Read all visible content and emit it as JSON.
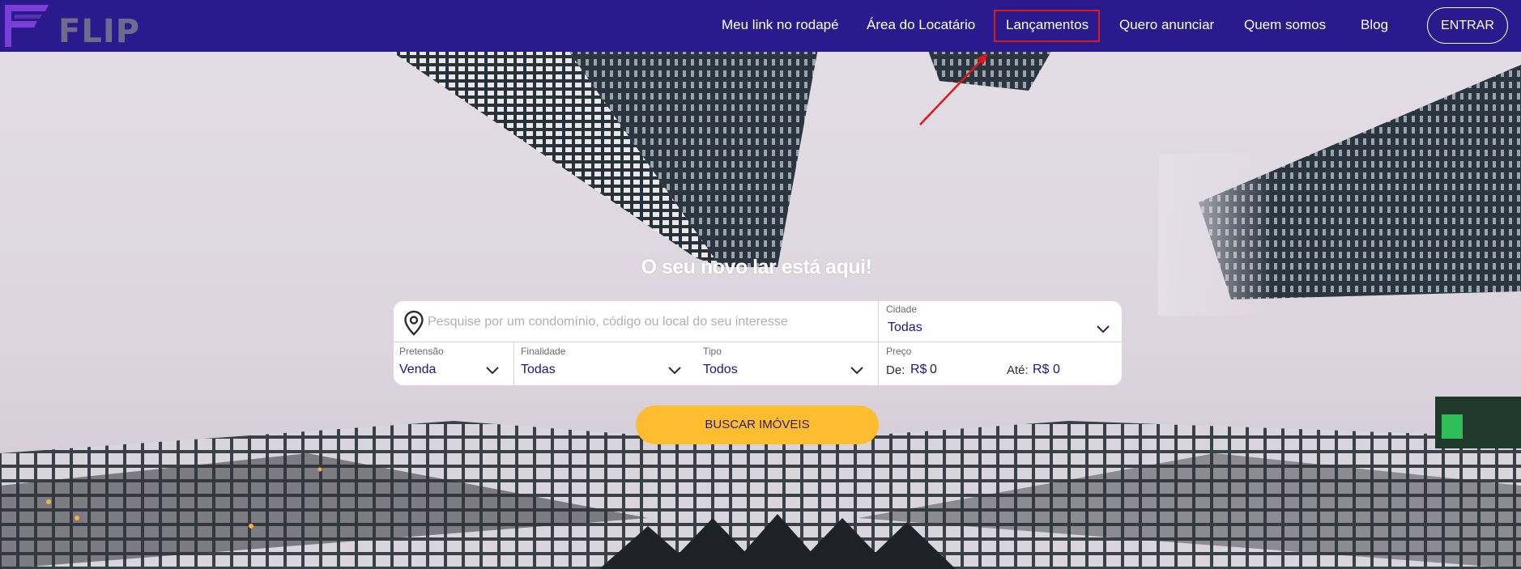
{
  "header": {
    "logo_text": "FLIP",
    "nav": [
      {
        "label": "Meu link no rodapé"
      },
      {
        "label": "Área do Locatário"
      },
      {
        "label": "Lançamentos"
      },
      {
        "label": "Quero anunciar"
      },
      {
        "label": "Quem somos"
      },
      {
        "label": "Blog"
      }
    ],
    "login_label": "ENTRAR"
  },
  "hero": {
    "headline": "O seu novo lar está aqui!"
  },
  "search": {
    "placeholder": "Pesquise por um condomínio, código ou local do seu interesse",
    "cidade": {
      "label": "Cidade",
      "value": "Todas"
    },
    "pretensao": {
      "label": "Pretensão",
      "value": "Venda"
    },
    "finalidade": {
      "label": "Finalidade",
      "value": "Todas"
    },
    "tipo": {
      "label": "Tipo",
      "value": "Todos"
    },
    "preco": {
      "label": "Preço",
      "de_label": "De:",
      "de_currency": "R$",
      "de_value": "0",
      "ate_label": "Até:",
      "ate_currency": "R$",
      "ate_value": "0"
    },
    "submit_label": "BUSCAR IMÓVEIS"
  },
  "colors": {
    "header_bg": "#2a1a8e",
    "accent": "#fdbd2e",
    "value_text": "#1e1780",
    "annotation": "#e01818"
  },
  "icons": [
    "location-pin-icon",
    "chevron-down-icon",
    "logo-f-icon"
  ]
}
